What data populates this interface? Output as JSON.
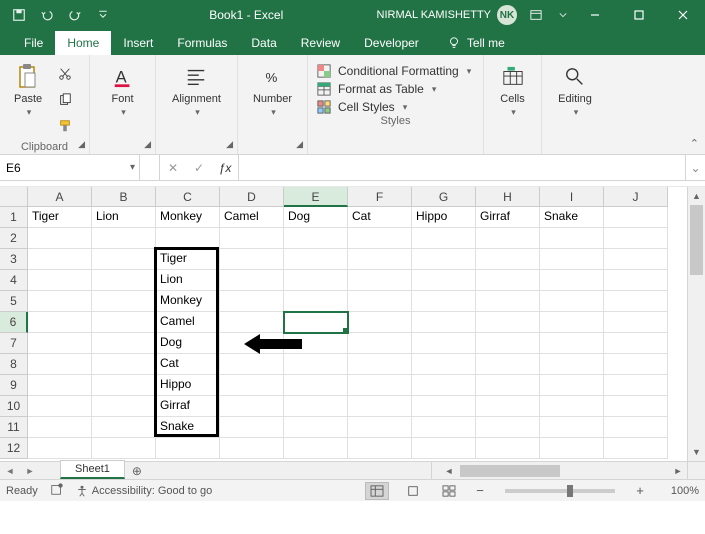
{
  "titlebar": {
    "document_title": "Book1 - Excel",
    "user_name": "NIRMAL KAMISHETTY",
    "user_initials": "NK"
  },
  "tabs": {
    "file": "File",
    "home": "Home",
    "insert": "Insert",
    "formulas": "Formulas",
    "data": "Data",
    "review": "Review",
    "developer": "Developer",
    "tellme": "Tell me"
  },
  "ribbon": {
    "clipboard": {
      "paste": "Paste",
      "label": "Clipboard"
    },
    "font": {
      "label": "Font",
      "button": "Font"
    },
    "alignment": {
      "label": "Alignment",
      "button": "Alignment"
    },
    "number": {
      "label": "Number",
      "button": "Number"
    },
    "styles": {
      "label": "Styles",
      "conditional": "Conditional Formatting",
      "table": "Format as Table",
      "cellstyles": "Cell Styles"
    },
    "cells": {
      "label": "Cells",
      "button": "Cells"
    },
    "editing": {
      "label": "Editing",
      "button": "Editing"
    }
  },
  "formula_bar": {
    "namebox": "E6",
    "formula": ""
  },
  "grid": {
    "columns": [
      "A",
      "B",
      "C",
      "D",
      "E",
      "F",
      "G",
      "H",
      "I",
      "J"
    ],
    "rows": [
      "1",
      "2",
      "3",
      "4",
      "5",
      "6",
      "7",
      "8",
      "9",
      "10",
      "11",
      "12"
    ],
    "selected_col": "E",
    "selected_row": "6",
    "active_cell": {
      "col": 4,
      "row": 5
    },
    "row1": [
      "Tiger",
      "Lion",
      "Monkey",
      "Camel",
      "Dog",
      "Cat",
      "Hippo",
      "Girraf",
      "Snake",
      ""
    ],
    "colC": [
      "",
      "",
      "Tiger",
      "Lion",
      "Monkey",
      "Camel",
      "Dog",
      "Cat",
      "Hippo",
      "Girraf",
      "Snake",
      ""
    ],
    "highlight_box": {
      "col": 2,
      "row_start": 2,
      "row_end": 10
    }
  },
  "sheetbar": {
    "sheet1": "Sheet1"
  },
  "statusbar": {
    "ready": "Ready",
    "accessibility": "Accessibility: Good to go",
    "zoom": "100%"
  }
}
